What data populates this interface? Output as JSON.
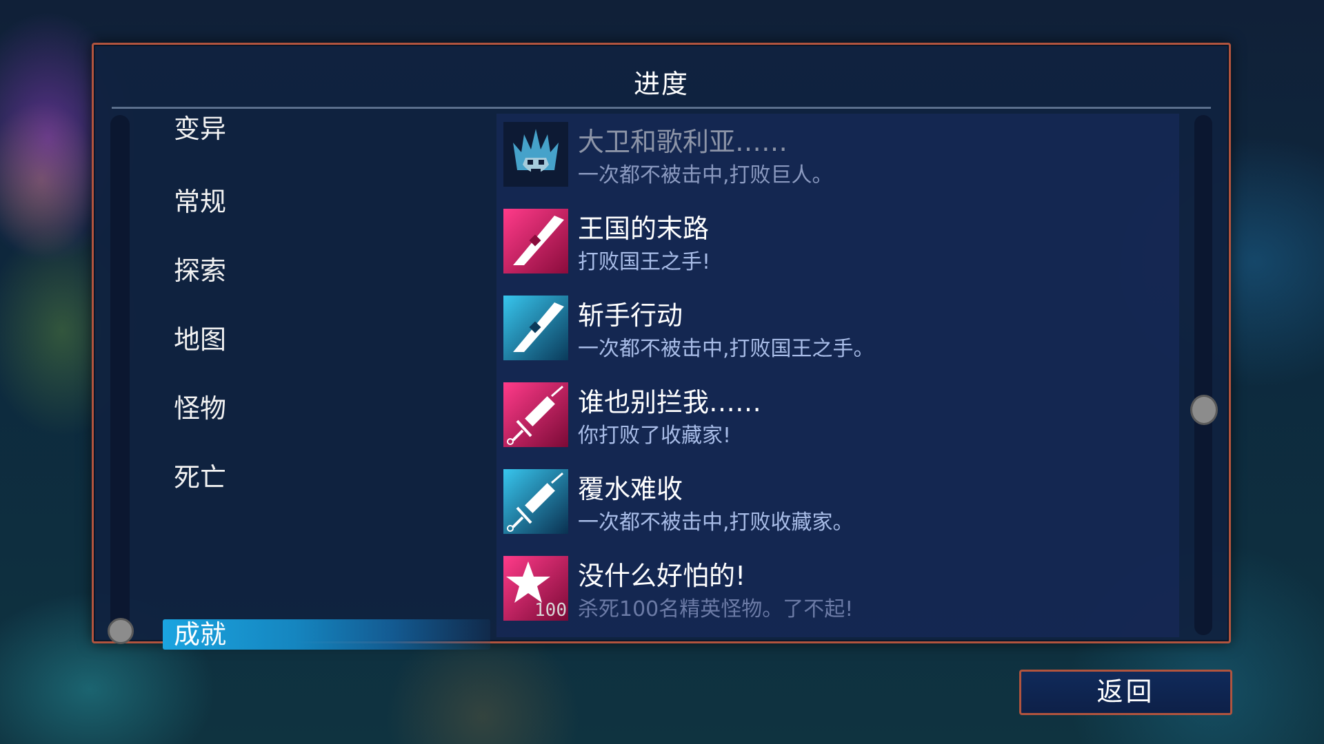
{
  "panel": {
    "title": "进度"
  },
  "categories": [
    {
      "label": "变异",
      "selected": false
    },
    {
      "label": "常规",
      "selected": false
    },
    {
      "label": "探索",
      "selected": false
    },
    {
      "label": "地图",
      "selected": false
    },
    {
      "label": "怪物",
      "selected": false
    },
    {
      "label": "死亡",
      "selected": false
    },
    {
      "label": "成就",
      "selected": true
    }
  ],
  "achievements": [
    {
      "title": "大卫和歌利亚……",
      "description": "一次都不被击中,打败巨人。",
      "icon": "giant-skull-icon"
    },
    {
      "title": "王国的末路",
      "description": "打败国王之手!",
      "icon": "pink-blade-icon"
    },
    {
      "title": "斩手行动",
      "description": "一次都不被击中,打败国王之手。",
      "icon": "blue-blade-icon"
    },
    {
      "title": "谁也别拦我……",
      "description": "你打败了收藏家!",
      "icon": "pink-syringe-icon"
    },
    {
      "title": "覆水难收",
      "description": "一次都不被击中,打败收藏家。",
      "icon": "blue-syringe-icon"
    },
    {
      "title": "没什么好怕的!",
      "description": "杀死100名精英怪物。了不起!",
      "icon": "pink-star-icon",
      "count": "100"
    }
  ],
  "buttons": {
    "back_label": "返回"
  },
  "colors": {
    "panel_border": "#b2543e",
    "selected_category": "#1ba4e0",
    "pink_accent": "#e0206e",
    "blue_accent": "#1aa6d6"
  }
}
